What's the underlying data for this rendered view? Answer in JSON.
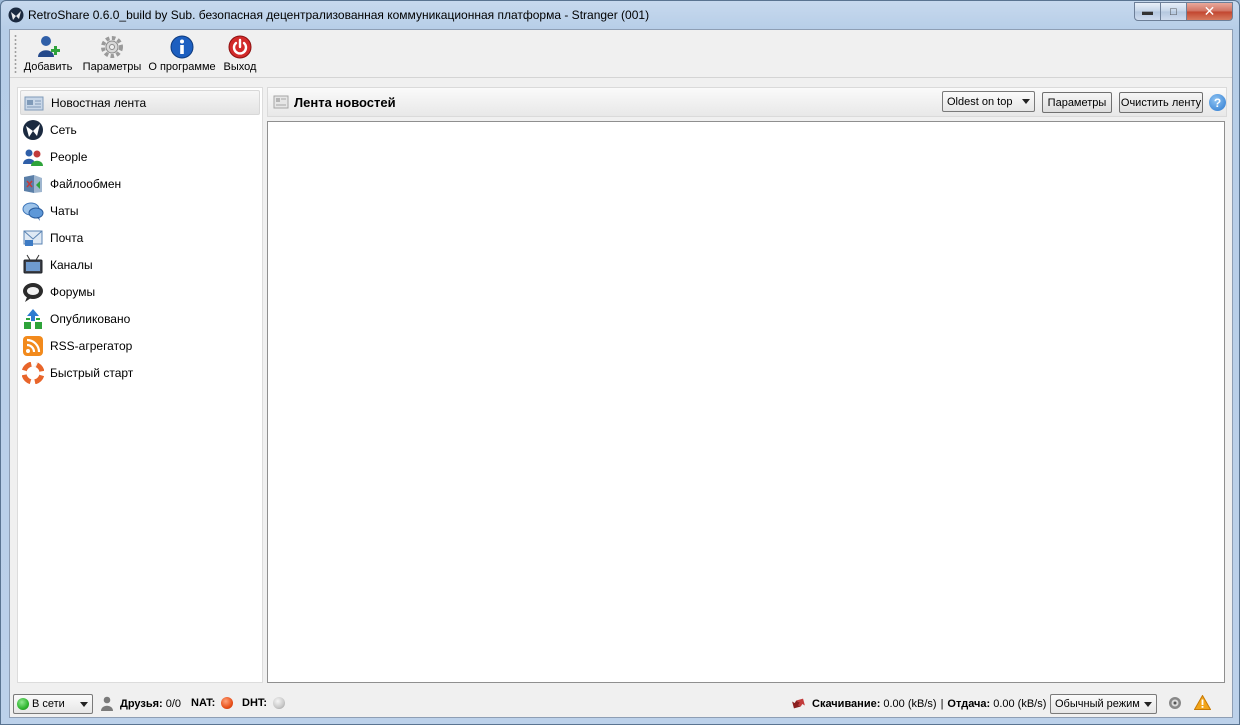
{
  "window": {
    "title": "RetroShare 0.6.0_build by Sub. безопасная децентрализованная коммуникационная платформа - Stranger (001)",
    "minimize_glyph": "▬",
    "maximize_glyph": "□",
    "close_glyph": "✕"
  },
  "toolbar": {
    "items": [
      {
        "label": "Добавить",
        "icon": "add-user-icon"
      },
      {
        "label": "Параметры",
        "icon": "gear-icon"
      },
      {
        "label": "О программе",
        "icon": "info-icon"
      },
      {
        "label": "Выход",
        "icon": "power-icon"
      }
    ]
  },
  "sidebar": {
    "items": [
      {
        "label": "Новостная лента",
        "icon": "newsfeed-icon",
        "active": true
      },
      {
        "label": "Сеть",
        "icon": "network-icon"
      },
      {
        "label": "People",
        "icon": "people-icon"
      },
      {
        "label": "Файлообмен",
        "icon": "file-sharing-icon"
      },
      {
        "label": "Чаты",
        "icon": "chat-icon"
      },
      {
        "label": "Почта",
        "icon": "mail-icon"
      },
      {
        "label": "Каналы",
        "icon": "channels-icon"
      },
      {
        "label": "Форумы",
        "icon": "forums-icon"
      },
      {
        "label": "Опубликовано",
        "icon": "published-icon"
      },
      {
        "label": "RSS-агрегатор",
        "icon": "rss-icon"
      },
      {
        "label": "Быстрый старт",
        "icon": "lifebuoy-icon"
      }
    ]
  },
  "main": {
    "title": "Лента новостей",
    "sort_select": "Oldest on top",
    "settings_button": "Параметры",
    "clear_button": "Очистить ленту",
    "help_glyph": "?"
  },
  "statusbar": {
    "status_select": "В сети",
    "friends_label": "Друзья:",
    "friends_value": "0/0",
    "nat_label": "NAT:",
    "dht_label": "DHT:",
    "download_label": "Скачивание:",
    "download_value": "0.00 (kB/s)",
    "separator": "|",
    "upload_label": "Отдача:",
    "upload_value": "0.00 (kB/s)",
    "mode_select": "Обычный режим"
  },
  "colors": {
    "nat_status": "#e8501a",
    "dht_status": "#c8c8c8",
    "online_status": "#2fb52f",
    "warning": "#f2a51a"
  }
}
